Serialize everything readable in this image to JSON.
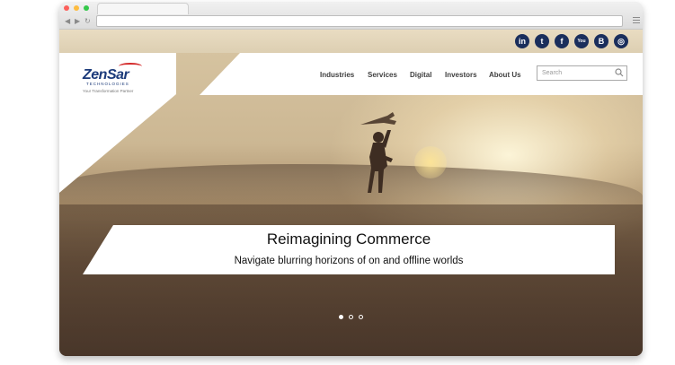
{
  "browser": {
    "back_icon": "back-arrow-icon",
    "forward_icon": "forward-arrow-icon",
    "reload_icon": "reload-icon",
    "menu_icon": "hamburger-menu-icon"
  },
  "site": {
    "logo": {
      "name": "ZenSar",
      "subtitle": "TECHNOLOGIES",
      "tagline": "Your Transformation Partner"
    },
    "social": [
      {
        "icon": "linkedin-icon",
        "glyph": "in"
      },
      {
        "icon": "twitter-icon",
        "glyph": "t"
      },
      {
        "icon": "facebook-icon",
        "glyph": "f"
      },
      {
        "icon": "youtube-icon",
        "glyph": "You"
      },
      {
        "icon": "blogger-icon",
        "glyph": "B"
      },
      {
        "icon": "instagram-icon",
        "glyph": "◎"
      }
    ],
    "nav": [
      {
        "label": "Industries"
      },
      {
        "label": "Services"
      },
      {
        "label": "Digital"
      },
      {
        "label": "Investors"
      },
      {
        "label": "About Us"
      }
    ],
    "search": {
      "placeholder": "Search",
      "icon": "search-icon"
    },
    "hero": {
      "title": "Reimagining Commerce",
      "subtitle": "Navigate blurring horizons of on and offline worlds"
    },
    "carousel": {
      "slides": 3,
      "active": 1
    }
  },
  "colors": {
    "brand_blue": "#1b3a7a",
    "brand_red": "#d42a2a",
    "social_bg": "#1a2e5c"
  }
}
